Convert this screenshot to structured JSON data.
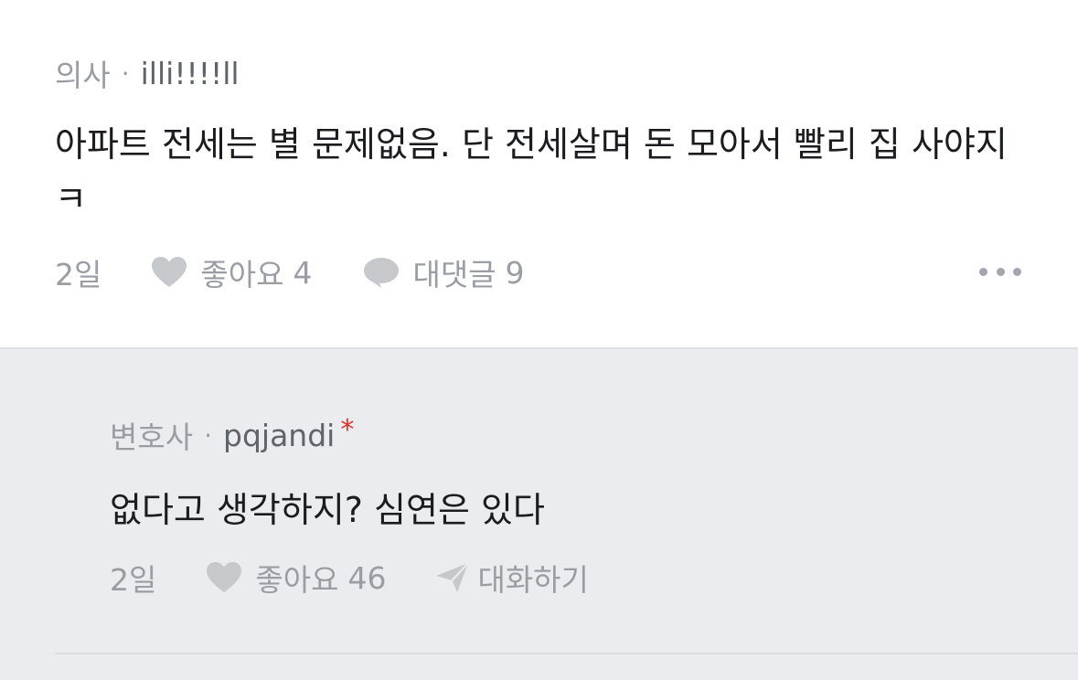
{
  "comment": {
    "job": "의사",
    "separator": "·",
    "nickname": "illi!!!!ll",
    "text": "아파트 전세는 별 문제없음. 단 전세살며 돈 모아서 빨리 집 사야지 ㅋ",
    "time": "2일",
    "like_label": "좋아요",
    "like_count": "4",
    "reply_label": "대댓글",
    "reply_count": "9"
  },
  "reply": {
    "job": "변호사",
    "separator": "·",
    "nickname": "pqjandi",
    "badge": "*",
    "text": "없다고 생각하지? 심연은 있다",
    "time": "2일",
    "like_label": "좋아요",
    "like_count": "46",
    "chat_label": "대화하기"
  },
  "colors": {
    "meta_gray": "#9a9da3",
    "text_black": "#1b1c1f",
    "reply_bg": "#ebecef",
    "badge_red": "#d9342b"
  },
  "icons": {
    "like": "heart-icon",
    "reply": "speech-bubble-icon",
    "more": "more-horizontal-icon",
    "chat": "paper-plane-icon"
  }
}
